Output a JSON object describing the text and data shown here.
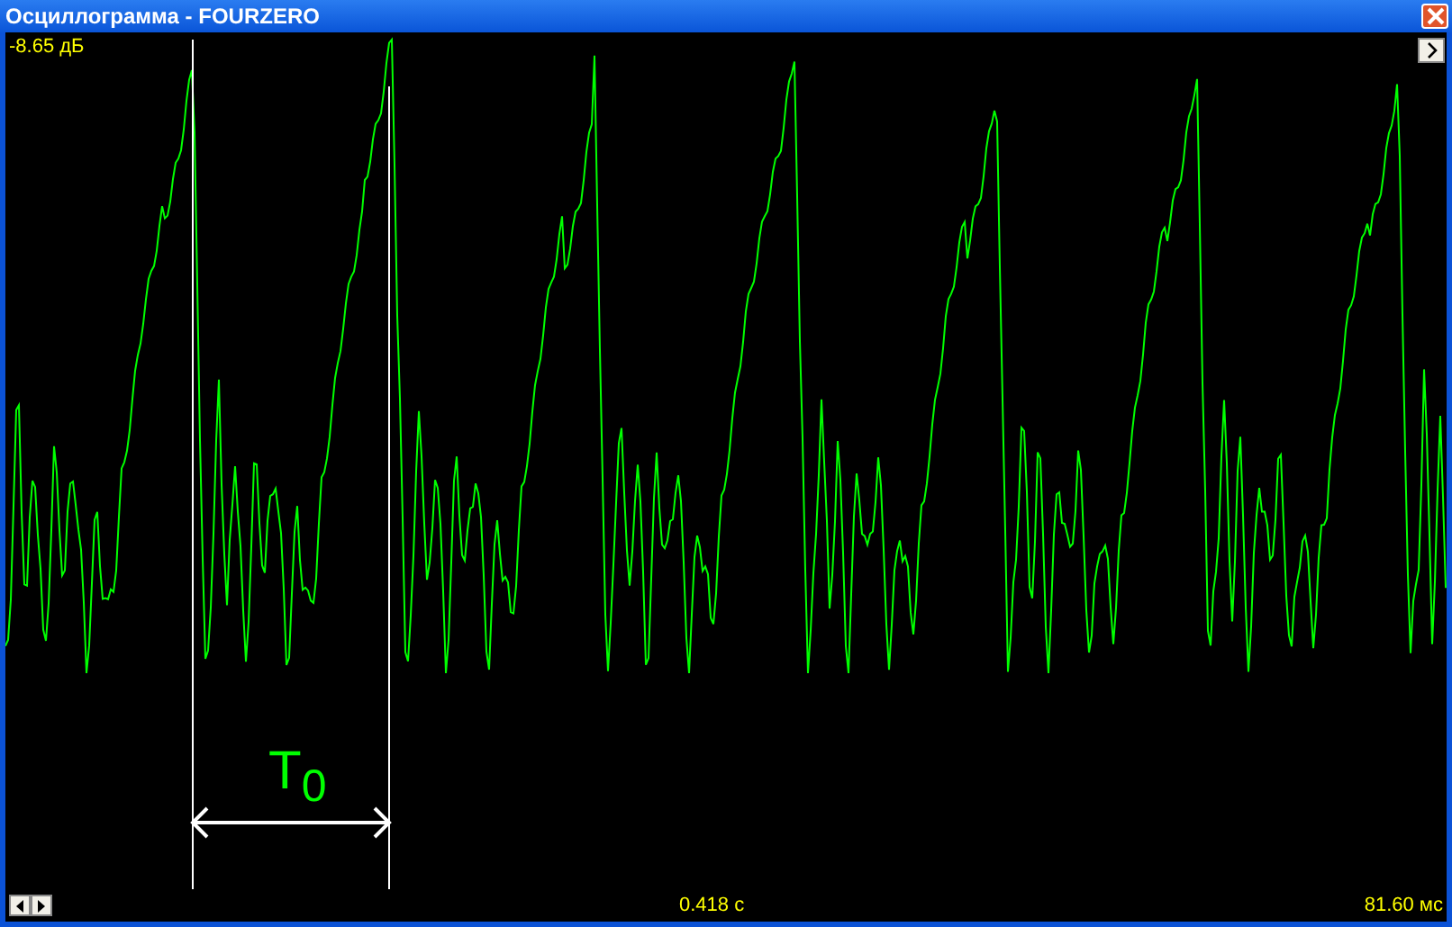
{
  "window": {
    "title": "Осциллограмма - FOURZERO"
  },
  "plot": {
    "level_reading": "-8.65 дБ",
    "annotation": "T$_{0}$"
  },
  "status_bar": {
    "time": "0.418 с",
    "period": "81.60 мс"
  }
}
